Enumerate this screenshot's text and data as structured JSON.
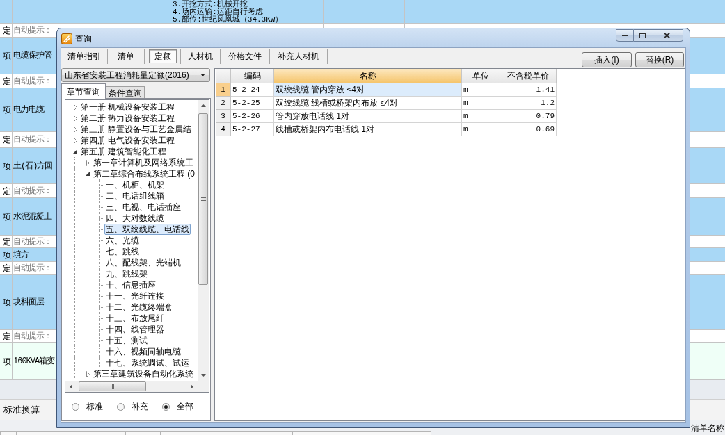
{
  "background": {
    "rows": [
      {
        "kind": "item",
        "selected": false,
        "features": [
          "3.开挖方式:机械开挖",
          "4.场内运输:运距自行考虑",
          "5.部位:世纪凤凰城（34.3KW）"
        ]
      },
      {
        "kind": "hint",
        "selected": false,
        "type": "定",
        "name": "自动提示："
      },
      {
        "kind": "item",
        "selected": false,
        "type": "项",
        "name": "电缆保护管"
      },
      {
        "kind": "hint",
        "selected": false,
        "type": "定",
        "name": "自动提示："
      },
      {
        "kind": "item",
        "selected": false,
        "type": "项",
        "name": "电力电缆"
      },
      {
        "kind": "hint",
        "selected": false,
        "type": "定",
        "name": "自动提示："
      },
      {
        "kind": "item",
        "selected": false,
        "type": "项",
        "name": "土(石)方回"
      },
      {
        "kind": "hint",
        "selected": false,
        "type": "定",
        "name": "自动提示："
      },
      {
        "kind": "item",
        "selected": false,
        "type": "项",
        "name": "水泥混凝土"
      },
      {
        "kind": "hint",
        "selected": false,
        "type": "定",
        "name": "自动提示："
      },
      {
        "kind": "item",
        "selected": false,
        "type": "项",
        "name": "填方"
      },
      {
        "kind": "hint",
        "selected": false,
        "type": "定",
        "name": "自动提示："
      },
      {
        "kind": "item",
        "selected": false,
        "type": "项",
        "name": "块料面层"
      },
      {
        "kind": "hint",
        "selected": false,
        "type": "定",
        "name": "自动提示："
      },
      {
        "kind": "item",
        "selected": true,
        "type": "项",
        "name": "160KVA箱变"
      }
    ],
    "toolbar": [
      "标准换算"
    ],
    "footer_label": "清单名称"
  },
  "dialog": {
    "title": "查询",
    "tabs": [
      {
        "label": "清单指引",
        "selected": false
      },
      {
        "label": "清单",
        "selected": false
      },
      {
        "label": "定额",
        "selected": true
      },
      {
        "label": "人材机",
        "selected": false
      },
      {
        "label": "价格文件",
        "selected": false
      },
      {
        "label": "补充人材机",
        "selected": false
      }
    ],
    "buttons": [
      "插入(I)",
      "替换(R)"
    ],
    "library": "山东省安装工程消耗量定额(2016)",
    "query_tabs": [
      {
        "label": "章节查询",
        "selected": true
      },
      {
        "label": "条件查询",
        "selected": false
      }
    ],
    "tree": [
      {
        "label": "第一册 机械设备安装工程",
        "expanded": false,
        "selected": false
      },
      {
        "label": "第二册 热力设备安装工程",
        "expanded": false,
        "selected": false
      },
      {
        "label": "第三册 静置设备与工艺金属结",
        "expanded": false,
        "selected": false
      },
      {
        "label": "第四册 电气设备安装工程",
        "expanded": false,
        "selected": false
      },
      {
        "label": "第五册 建筑智能化工程",
        "expanded": true,
        "selected": false,
        "children": [
          {
            "label": "第一章计算机及网络系统工",
            "expanded": false,
            "selected": false
          },
          {
            "label": "第二章综合布线系统工程 (0",
            "expanded": true,
            "selected": false,
            "children": [
              {
                "label": "一、机柜、机架",
                "selected": false
              },
              {
                "label": "二、电话组线箱",
                "selected": false
              },
              {
                "label": "三、电视、电话插座",
                "selected": false
              },
              {
                "label": "四、大对数线缆",
                "selected": false
              },
              {
                "label": "五、双绞线缆、电话线",
                "selected": true
              },
              {
                "label": "六、光缆",
                "selected": false
              },
              {
                "label": "七、跳线",
                "selected": false
              },
              {
                "label": "八、配线架、光端机",
                "selected": false
              },
              {
                "label": "九、跳线架",
                "selected": false
              },
              {
                "label": "十、信息插座",
                "selected": false
              },
              {
                "label": "十一、光纤连接",
                "selected": false
              },
              {
                "label": "十二、光缆终端盒",
                "selected": false
              },
              {
                "label": "十三、布放尾纤",
                "selected": false
              },
              {
                "label": "十四、线管理器",
                "selected": false
              },
              {
                "label": "十五、测试",
                "selected": false
              },
              {
                "label": "十六、视频同轴电缆",
                "selected": false
              },
              {
                "label": "十七、系统调试、试运",
                "selected": false
              }
            ]
          },
          {
            "label": "第三章建筑设备自动化系统",
            "expanded": false,
            "selected": false
          }
        ]
      }
    ],
    "filters": [
      {
        "label": "标准",
        "selected": false
      },
      {
        "label": "补充",
        "selected": false
      },
      {
        "label": "全部",
        "selected": true
      }
    ],
    "table": {
      "columns": [
        {
          "label": "编码",
          "selected": false
        },
        {
          "label": "名称",
          "selected": true
        },
        {
          "label": "单位",
          "selected": false
        },
        {
          "label": "不含税单价",
          "selected": false
        }
      ],
      "rows": [
        {
          "number": "1",
          "selected": true,
          "cells": [
            "5-2-24",
            "双绞线缆 管内穿放 ≤4对",
            "m",
            "1.41"
          ]
        },
        {
          "number": "2",
          "selected": false,
          "cells": [
            "5-2-25",
            "双绞线缆 线槽或桥架内布放 ≤4对",
            "m",
            "1.2"
          ]
        },
        {
          "number": "3",
          "selected": false,
          "cells": [
            "5-2-26",
            "管内穿放电话线 1对",
            "m",
            "0.79"
          ]
        },
        {
          "number": "4",
          "selected": false,
          "cells": [
            "5-2-27",
            "线槽或桥架内布电话线 1对",
            "m",
            "0.69"
          ]
        }
      ]
    }
  }
}
